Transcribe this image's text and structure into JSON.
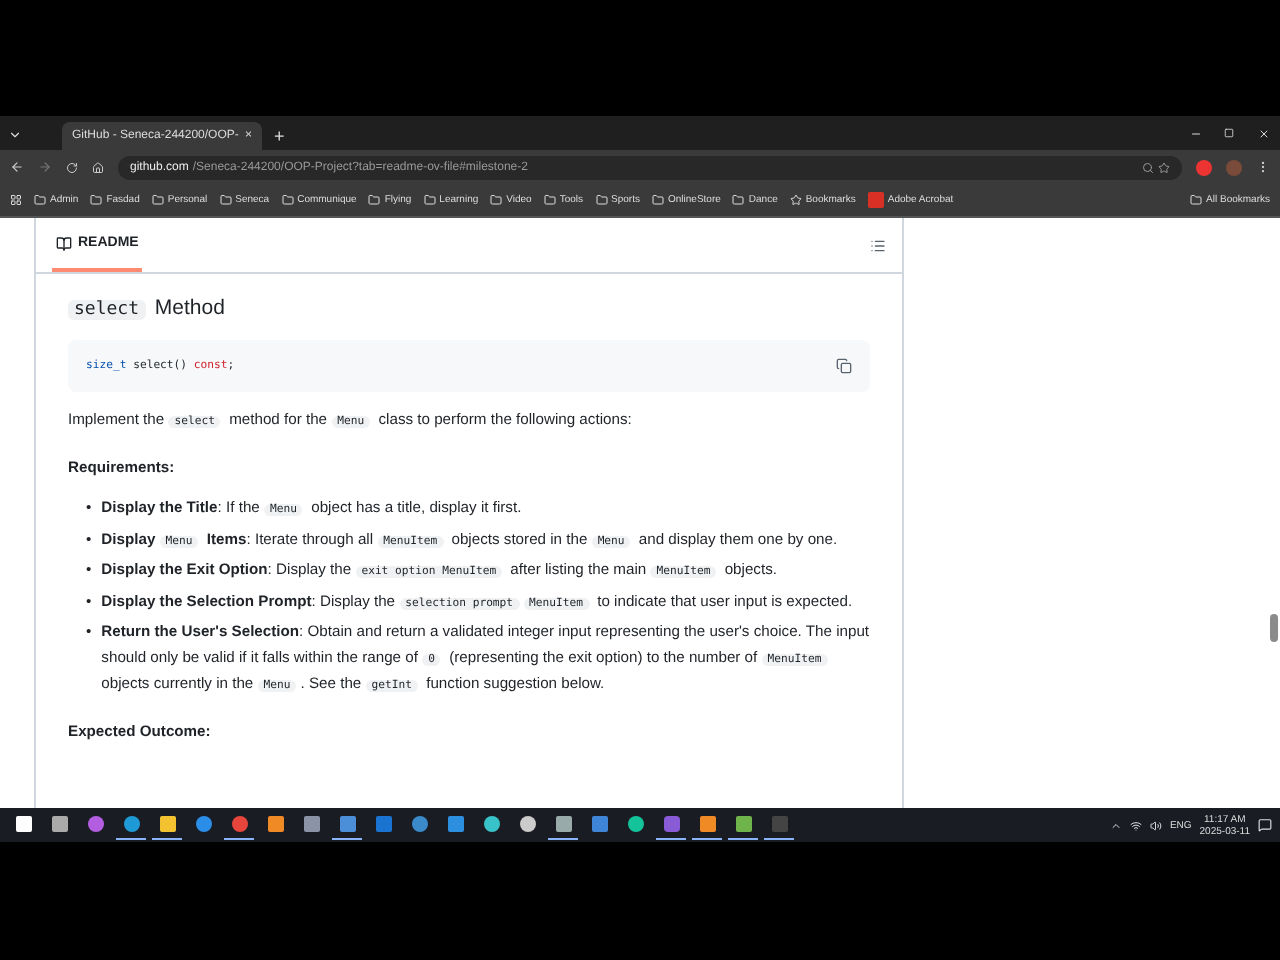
{
  "browser": {
    "tab": {
      "title": "GitHub - Seneca-244200/OOP-",
      "close": "×",
      "selected": true
    },
    "new_tab": "+",
    "url": {
      "host": "github.com",
      "path": "/Seneca-244200/OOP-Project?tab=readme-ov-file#milestone-2"
    },
    "bookmarks": [
      {
        "kind": "folder",
        "label": "Admin"
      },
      {
        "kind": "folder",
        "label": "Fasdad"
      },
      {
        "kind": "folder",
        "label": "Personal"
      },
      {
        "kind": "folder",
        "label": "Seneca"
      },
      {
        "kind": "folder",
        "label": "Communique"
      },
      {
        "kind": "folder",
        "label": "Flying"
      },
      {
        "kind": "folder",
        "label": "Learning"
      },
      {
        "kind": "folder",
        "label": "Video"
      },
      {
        "kind": "folder",
        "label": "Tools"
      },
      {
        "kind": "folder",
        "label": "Sports"
      },
      {
        "kind": "folder",
        "label": "OnlineStore"
      },
      {
        "kind": "folder",
        "label": "Dance"
      },
      {
        "kind": "star",
        "label": "Bookmarks"
      },
      {
        "kind": "acrobat",
        "label": "Adobe Acrobat"
      }
    ],
    "all_bookmarks": "All Bookmarks"
  },
  "readme": {
    "tab": "README",
    "selected": true,
    "heading": [
      {
        "kind": "code",
        "text": "select"
      },
      {
        "kind": "text",
        "text": " Method"
      }
    ],
    "code_block": [
      {
        "kind": "type",
        "text": "size_t"
      },
      {
        "kind": "text",
        "text": " select() "
      },
      {
        "kind": "keyword",
        "text": "const"
      },
      {
        "kind": "text",
        "text": ";"
      }
    ],
    "intro": [
      {
        "kind": "text",
        "text": "Implement the "
      },
      {
        "kind": "code",
        "text": "select"
      },
      {
        "kind": "text",
        "text": " method for the "
      },
      {
        "kind": "code",
        "text": "Menu"
      },
      {
        "kind": "text",
        "text": " class to perform the following actions:"
      }
    ],
    "requirements_title": "Requirements:",
    "requirements": [
      {
        "marker": "•",
        "segments": [
          {
            "kind": "bold",
            "text": "Display the Title"
          },
          {
            "kind": "text",
            "text": ": If the "
          },
          {
            "kind": "code",
            "text": "Menu"
          },
          {
            "kind": "text",
            "text": " object has a title, display it first."
          }
        ]
      },
      {
        "marker": "•",
        "segments": [
          {
            "kind": "bold",
            "text": "Display "
          },
          {
            "kind": "code",
            "text": "Menu"
          },
          {
            "kind": "bold",
            "text": " Items"
          },
          {
            "kind": "text",
            "text": ": Iterate through all "
          },
          {
            "kind": "code",
            "text": "MenuItem"
          },
          {
            "kind": "text",
            "text": " objects stored in the "
          },
          {
            "kind": "code",
            "text": "Menu"
          },
          {
            "kind": "text",
            "text": " and display them one by one."
          }
        ]
      },
      {
        "marker": "•",
        "segments": [
          {
            "kind": "bold",
            "text": "Display the Exit Option"
          },
          {
            "kind": "text",
            "text": ": Display the "
          },
          {
            "kind": "code",
            "text": "exit option MenuItem"
          },
          {
            "kind": "text",
            "text": " after listing the main "
          },
          {
            "kind": "code",
            "text": "MenuItem"
          },
          {
            "kind": "text",
            "text": " objects."
          }
        ]
      },
      {
        "marker": "•",
        "segments": [
          {
            "kind": "bold",
            "text": "Display the Selection Prompt"
          },
          {
            "kind": "text",
            "text": ": Display the "
          },
          {
            "kind": "code",
            "text": "selection prompt"
          },
          {
            "kind": "code",
            "text": "MenuItem"
          },
          {
            "kind": "text",
            "text": " to indicate that user input is expected."
          }
        ]
      },
      {
        "marker": "•",
        "segments": [
          {
            "kind": "bold",
            "text": "Return the User's Selection"
          },
          {
            "kind": "text",
            "text": ": Obtain and return a validated integer input representing the user's choice. The input should only be valid if it falls within the range of "
          },
          {
            "kind": "code",
            "text": "0"
          },
          {
            "kind": "text",
            "text": " (representing the exit option) to the number of "
          },
          {
            "kind": "code",
            "text": "MenuItem"
          },
          {
            "kind": "text",
            "text": " objects currently in the "
          },
          {
            "kind": "code",
            "text": "Menu"
          },
          {
            "kind": "text",
            "text": ". See the "
          },
          {
            "kind": "code",
            "text": "getInt"
          },
          {
            "kind": "text",
            "text": " function suggestion below."
          }
        ]
      }
    ],
    "outcome_title": "Expected Outcome:"
  },
  "taskbar": {
    "apps": [
      {
        "kind": "search",
        "active": false
      },
      {
        "kind": "tasks",
        "active": false
      },
      {
        "kind": "copilot",
        "active": false
      },
      {
        "kind": "edge",
        "active": true
      },
      {
        "kind": "files",
        "active": true
      },
      {
        "kind": "ie",
        "active": false
      },
      {
        "kind": "chrome",
        "active": true
      },
      {
        "kind": "orange",
        "active": false
      },
      {
        "kind": "camera",
        "active": false
      },
      {
        "kind": "network",
        "active": true
      },
      {
        "kind": "outlook",
        "active": false
      },
      {
        "kind": "globe",
        "active": false
      },
      {
        "kind": "mail",
        "active": false
      },
      {
        "kind": "ring",
        "active": false
      },
      {
        "kind": "mic",
        "active": false
      },
      {
        "kind": "calc",
        "active": true
      },
      {
        "kind": "sheet",
        "active": false
      },
      {
        "kind": "grammarly",
        "active": false
      },
      {
        "kind": "vs",
        "active": true
      },
      {
        "kind": "orange",
        "active": true
      },
      {
        "kind": "remote",
        "active": true
      },
      {
        "kind": "terminal",
        "active": true
      }
    ],
    "language": "ENG",
    "time": "11:17 AM",
    "date": "2025-03-11"
  }
}
